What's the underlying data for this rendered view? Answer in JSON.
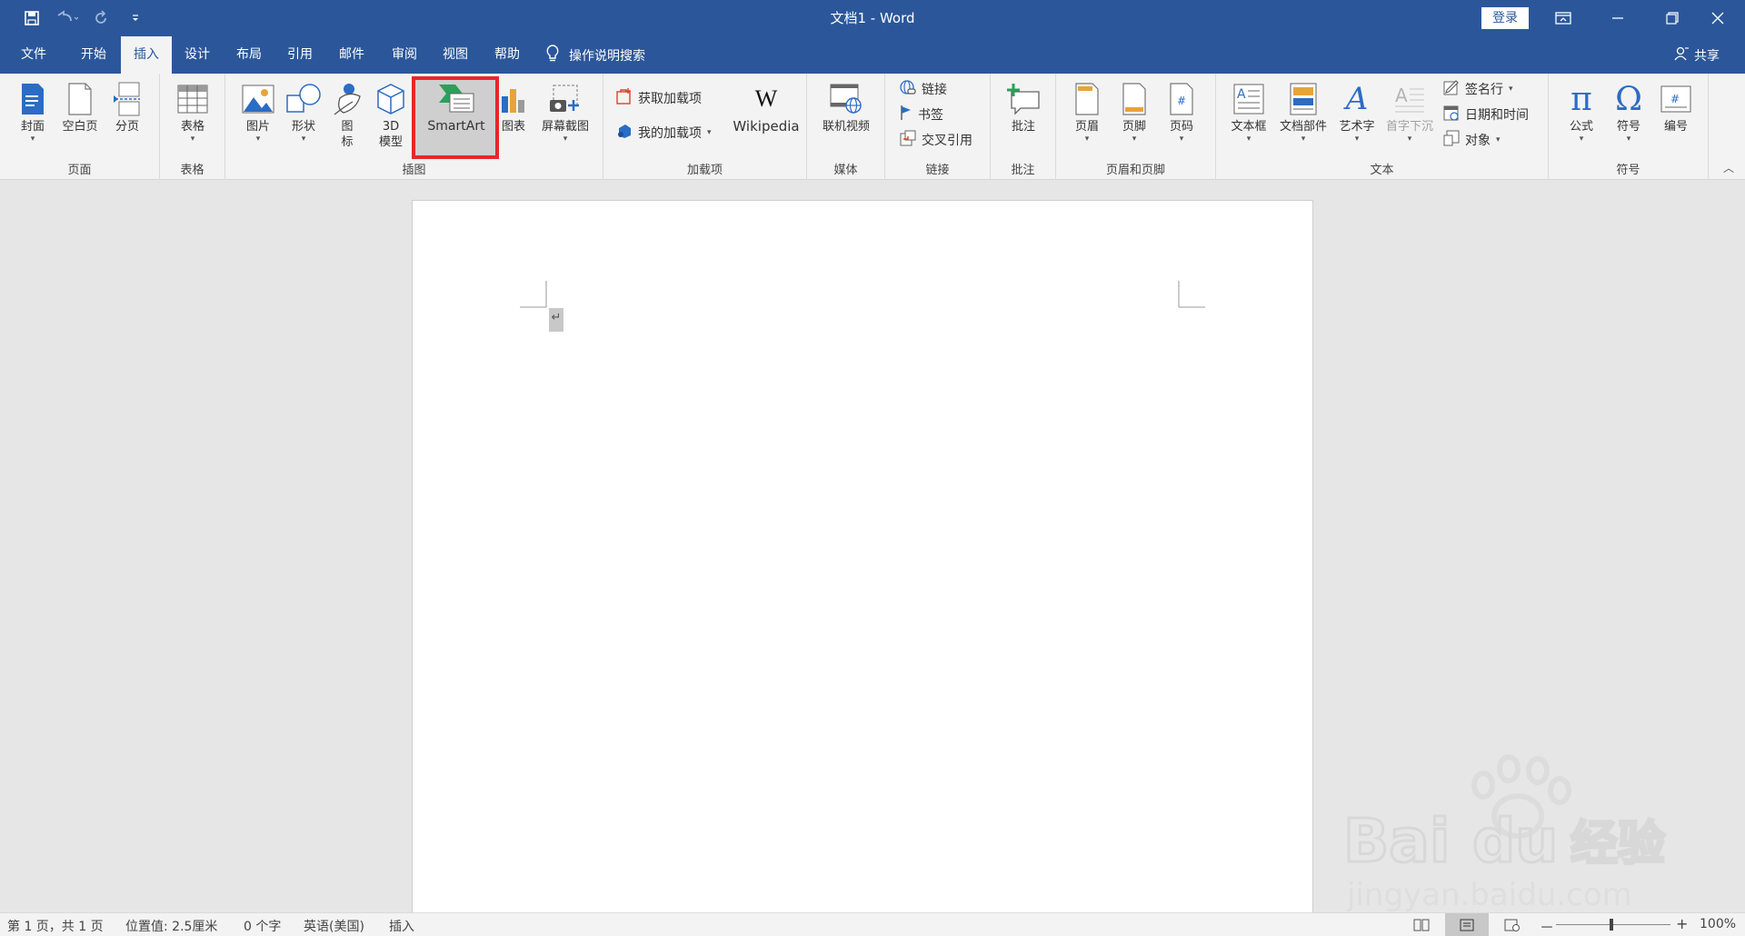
{
  "titlebar": {
    "title": "文档1  -  Word",
    "signin": "登录"
  },
  "tabs": [
    {
      "label": "文件"
    },
    {
      "label": "开始"
    },
    {
      "label": "插入"
    },
    {
      "label": "设计"
    },
    {
      "label": "布局"
    },
    {
      "label": "引用"
    },
    {
      "label": "邮件"
    },
    {
      "label": "审阅"
    },
    {
      "label": "视图"
    },
    {
      "label": "帮助"
    }
  ],
  "active_tab": "插入",
  "tellme": "操作说明搜索",
  "share": "共享",
  "ribbon": {
    "pages": {
      "label": "页面",
      "cover": "封面",
      "blank": "空白页",
      "break": "分页"
    },
    "tables": {
      "label": "表格",
      "table": "表格"
    },
    "illustrations": {
      "label": "插图",
      "pictures": "图片",
      "shapes": "形状",
      "icons_l1": "图",
      "icons_l2": "标",
      "model_l1": "3D",
      "model_l2": "模型",
      "smartart": "SmartArt",
      "chart": "图表",
      "screenshot": "屏幕截图"
    },
    "addins": {
      "label": "加载项",
      "get": "获取加载项",
      "my": "我的加载项",
      "wikipedia": "Wikipedia",
      "wiki_logo": "W"
    },
    "media": {
      "label": "媒体",
      "video": "联机视频"
    },
    "links": {
      "label": "链接",
      "link": "链接",
      "bookmark": "书签",
      "crossref": "交叉引用"
    },
    "comments": {
      "label": "批注",
      "comment": "批注"
    },
    "headerfooter": {
      "label": "页眉和页脚",
      "header": "页眉",
      "footer": "页脚",
      "pagenum": "页码"
    },
    "text": {
      "label": "文本",
      "textbox": "文本框",
      "quickparts": "文档部件",
      "wordart": "艺术字",
      "dropcap": "首字下沉",
      "signature": "签名行",
      "datetime": "日期和时间",
      "object": "对象"
    },
    "symbols": {
      "label": "符号",
      "equation": "公式",
      "symbol": "符号",
      "number": "编号"
    }
  },
  "document": {
    "paragraph_mark": "↵"
  },
  "status": {
    "page": "第 1 页，共 1 页",
    "position": "位置值: 2.5厘米",
    "words": "0 个字",
    "language": "英语(美国)",
    "mode": "插入",
    "zoom": "100%",
    "zoom_minus": "－",
    "zoom_plus": "+"
  },
  "watermark": {
    "brand": "Bai du 经验",
    "url": "jingyan.baidu.com"
  },
  "colors": {
    "word_blue": "#2b579a",
    "ribbon_bg": "#f3f3f3",
    "highlight": "#e8262b"
  }
}
